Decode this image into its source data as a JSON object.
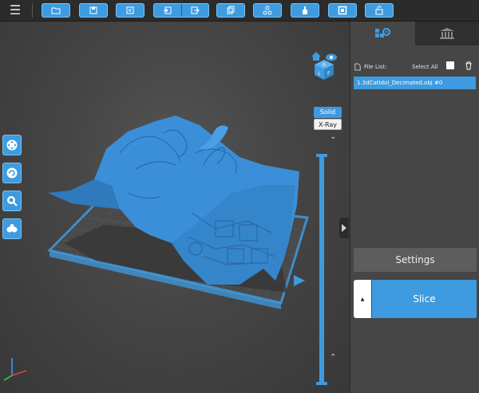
{
  "toolbar": {
    "menu_glyph": "☰",
    "buttons": [
      "open-file-icon",
      "save-icon",
      "edit-icon",
      "import-icon",
      "export-icon",
      "copy-icon",
      "support-icon",
      "bottle-icon",
      "frame-icon",
      "lock-icon"
    ]
  },
  "viewport": {
    "view_cube": {
      "top": "A",
      "left": "L",
      "front": "F"
    },
    "modes": {
      "solid": "Solid",
      "xray": "X-Ray"
    },
    "tools": [
      "move-icon",
      "rotate-icon",
      "zoom-icon",
      "layers-icon"
    ]
  },
  "panel": {
    "file_list_label": "File List:",
    "select_all_label": "Select All",
    "files": [
      "1.3dCatIdol_Decimated.obj #0"
    ],
    "settings_label": "Settings",
    "slice_label": "Slice",
    "slice_arrow": "▲"
  },
  "colors": {
    "accent": "#3e9bdf",
    "model": "#3b8fd8",
    "panel": "#464646"
  }
}
